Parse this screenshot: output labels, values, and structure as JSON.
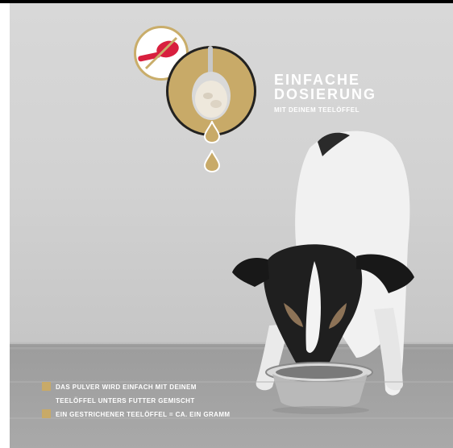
{
  "colors": {
    "accent_gold": "#c8aa68",
    "prohibition_red": "#d81f3e",
    "text_white": "#ffffff"
  },
  "icons": {
    "prohibited_spoon": "red-spoon-crossed-icon",
    "spoon_with_powder": "spoon-powder-icon",
    "drops": "drop-icon"
  },
  "headline": {
    "line1": "EINFACHE",
    "line2": "DOSIERUNG",
    "subline": "MIT DEINEM TEELÖFFEL"
  },
  "bullets": {
    "item1_line1": "DAS PULVER WIRD EINFACH MIT DEINEM",
    "item1_line2": "TEELÖFFEL UNTERS FUTTER GEMISCHT",
    "item2": "EIN GESTRICHENER TEELÖFFEL = CA. EIN GRAMM"
  }
}
